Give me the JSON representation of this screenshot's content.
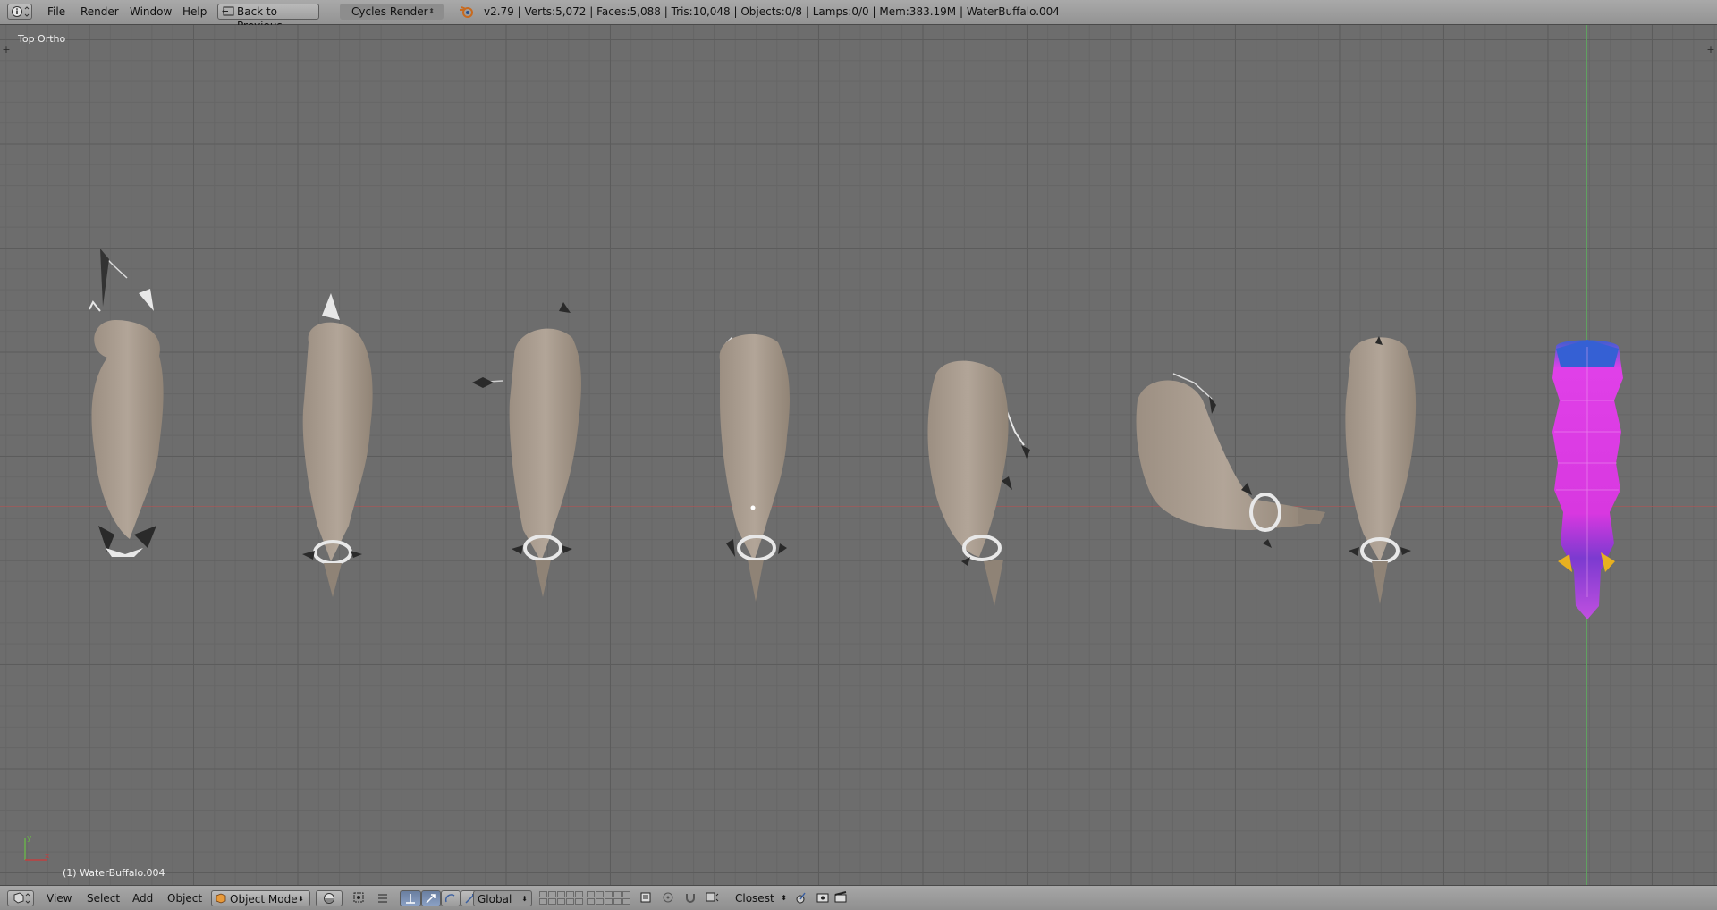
{
  "top_header": {
    "editor_icon": "info-icon",
    "menus": [
      "File",
      "Render",
      "Window",
      "Help"
    ],
    "back_button_label": "Back to Previous",
    "back_button_icon": "screen-back-icon",
    "render_engine": "Cycles Render",
    "blender_logo_icon": "blender-logo-icon",
    "stats": "v2.79 | Verts:5,072 | Faces:5,088 | Tris:10,048 | Objects:0/8 | Lamps:0/0 | Mem:383.19M | WaterBuffalo.004"
  },
  "viewport": {
    "view_name": "Top Ortho",
    "active_object_label": "(1) WaterBuffalo.004",
    "left_tab_glyph": "+",
    "right_tab_glyph": "+",
    "colors": {
      "background": "#6d6d6d",
      "x_axis": "#a05a5a",
      "y_axis": "#5ea55e",
      "model": "#a89a8c",
      "weight_paint_main": "#e040e8",
      "weight_paint_head": "#3060d0",
      "weight_paint_tail": "#8040d0",
      "weight_paint_accent": "#e8b020"
    },
    "model_count": 8
  },
  "bottom_header": {
    "editor_icon": "3d-view-icon",
    "menus": [
      "View",
      "Select",
      "Add",
      "Object"
    ],
    "mode": "Object Mode",
    "mode_icon": "cube-icon",
    "shading_icon": "sphere-shading-icon",
    "pivot_icon": "pivot-icon",
    "transform_icons": [
      "manipulator-icon",
      "translate-icon",
      "rotate-icon",
      "scale-icon"
    ],
    "orientation": "Global",
    "snap_target": "Closest",
    "extra_icons": [
      "lock-camera-icon",
      "render-icon",
      "clapper-icon"
    ]
  }
}
